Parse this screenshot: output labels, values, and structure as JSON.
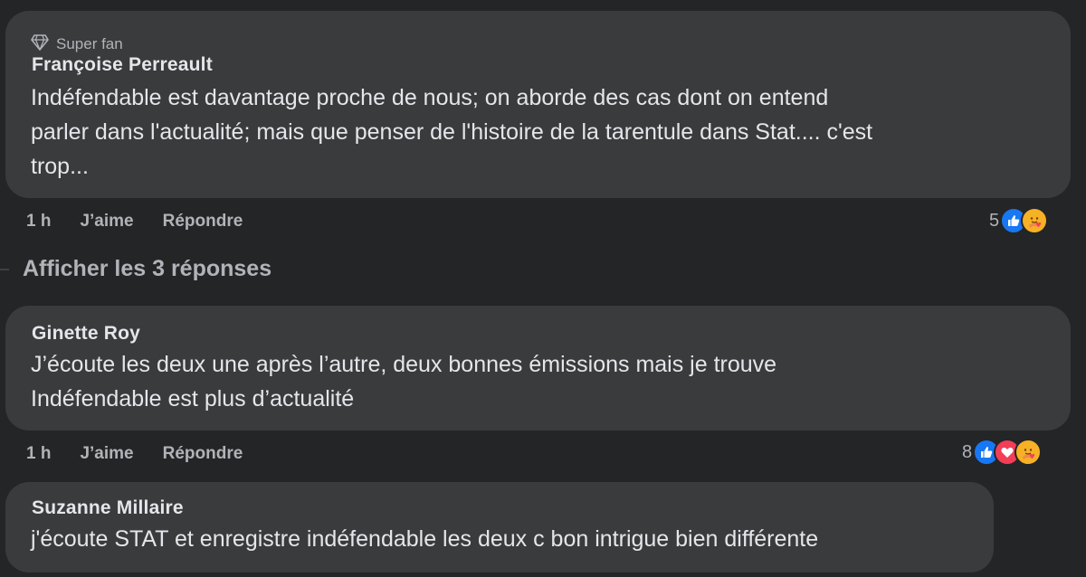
{
  "comments": [
    {
      "badge": "Super fan",
      "author": "Françoise Perreault",
      "lines": [
        "Indéfendable est davantage proche de nous; on aborde des cas dont on entend",
        "parler dans l'actualité; mais que penser de l'histoire de la tarentule dans Stat.... c'est",
        "trop..."
      ],
      "time": "1 h",
      "like_label": "J’aime",
      "reply_label": "Répondre",
      "reaction_count": "5",
      "reactions": [
        "like-icon",
        "care-icon"
      ]
    },
    {
      "author": "Ginette Roy",
      "lines": [
        "J’écoute les deux une après l’autre, deux bonnes émissions mais je trouve",
        "Indéfendable est plus d’actualité"
      ],
      "time": "1 h",
      "like_label": "J’aime",
      "reply_label": "Répondre",
      "reaction_count": "8",
      "reactions": [
        "like-icon",
        "love-icon",
        "care-icon"
      ]
    },
    {
      "author": "Suzanne Millaire",
      "lines": [
        "j'écoute STAT et enregistre indéfendable les deux c bon intrigue bien différente"
      ]
    }
  ],
  "replies_link": "Afficher les 3 réponses",
  "colors": {
    "background": "#242526",
    "bubble": "#3a3b3c",
    "primary_text": "#e4e6eb",
    "secondary_text": "#b0b3b8",
    "like_blue": "#1877f2",
    "love_red": "#f33e58",
    "care_yellow": "#f7b125"
  }
}
